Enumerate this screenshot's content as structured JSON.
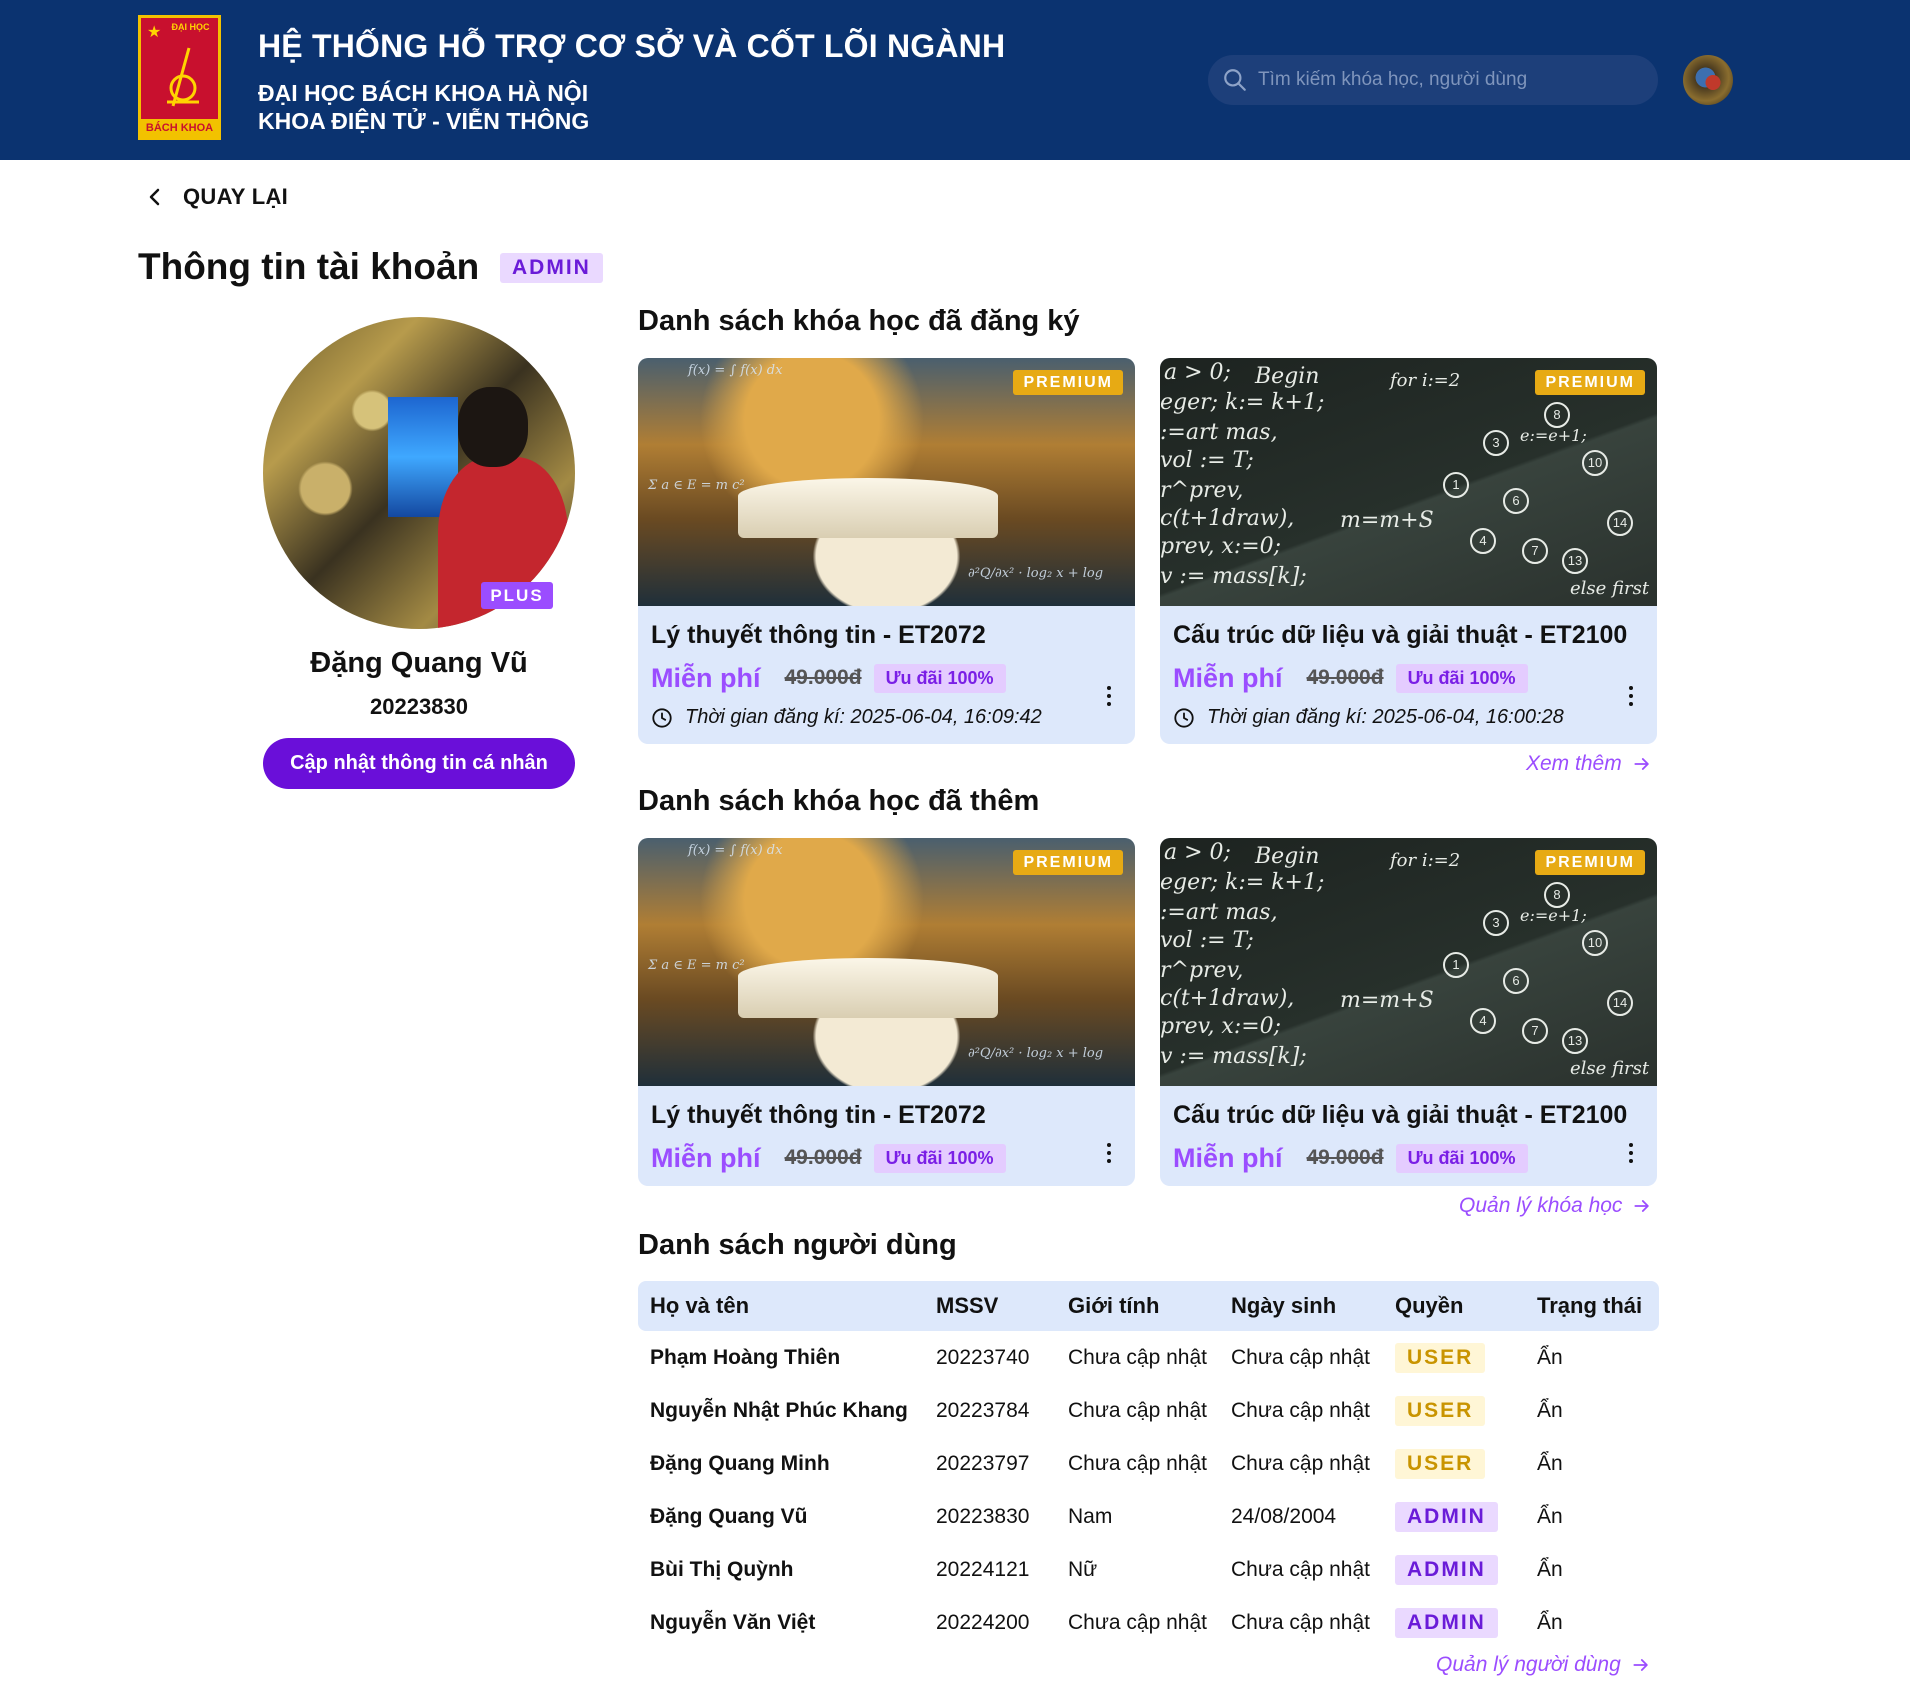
{
  "header": {
    "logo_top_text": "ĐẠI HỌC",
    "logo_bottom_text": "BÁCH KHOA",
    "title": "HỆ THỐNG HỖ TRỢ CƠ SỞ VÀ CỐT LÕI NGÀNH",
    "subtitle_1": "ĐẠI HỌC BÁCH KHOA HÀ NỘI",
    "subtitle_2": "KHOA ĐIỆN TỬ - VIỄN THÔNG",
    "search_placeholder": "Tìm kiếm khóa học, người dùng",
    "search_value": ""
  },
  "nav": {
    "back_label": "QUAY LẠI"
  },
  "page": {
    "title": "Thông tin tài khoản",
    "role_badge": "ADMIN"
  },
  "profile": {
    "tier_badge": "PLUS",
    "name": "Đặng Quang Vũ",
    "student_id": "20223830",
    "update_button": "Cập nhật thông tin cá nhân"
  },
  "registered": {
    "title": "Danh sách khóa học đã đăng ký",
    "more_label": "Xem thêm",
    "courses": [
      {
        "badge": "PREMIUM",
        "title": "Lý thuyết thông tin - ET2072",
        "price": "Miễn phí",
        "old_price": "49.000đ",
        "discount": "Ưu đãi 100%",
        "reg_time": "Thời gian đăng kí: 2025-06-04, 16:09:42"
      },
      {
        "badge": "PREMIUM",
        "title": "Cấu trúc dữ liệu và giải thuật - ET2100",
        "price": "Miễn phí",
        "old_price": "49.000đ",
        "discount": "Ưu đãi 100%",
        "reg_time": "Thời gian đăng kí: 2025-06-04, 16:00:28"
      }
    ]
  },
  "added": {
    "title": "Danh sách khóa học đã thêm",
    "more_label": "Quản lý khóa học",
    "courses": [
      {
        "badge": "PREMIUM",
        "title": "Lý thuyết thông tin - ET2072",
        "price": "Miễn phí",
        "old_price": "49.000đ",
        "discount": "Ưu đãi 100%"
      },
      {
        "badge": "PREMIUM",
        "title": "Cấu trúc dữ liệu và giải thuật - ET2100",
        "price": "Miễn phí",
        "old_price": "49.000đ",
        "discount": "Ưu đãi 100%"
      }
    ]
  },
  "users": {
    "title": "Danh sách người dùng",
    "more_label": "Quản lý người dùng",
    "columns": [
      "Họ và tên",
      "MSSV",
      "Giới tính",
      "Ngày sinh",
      "Quyền",
      "Trạng thái"
    ],
    "rows": [
      [
        "Phạm Hoàng Thiên",
        "20223740",
        "Chưa cập nhật",
        "Chưa cập nhật",
        "USER",
        "Ẩn"
      ],
      [
        "Nguyễn Nhật Phúc Khang",
        "20223784",
        "Chưa cập nhật",
        "Chưa cập nhật",
        "USER",
        "Ẩn"
      ],
      [
        "Đặng Quang Minh",
        "20223797",
        "Chưa cập nhật",
        "Chưa cập nhật",
        "USER",
        "Ẩn"
      ],
      [
        "Đặng Quang Vũ",
        "20223830",
        "Nam",
        "24/08/2004",
        "ADMIN",
        "Ẩn"
      ],
      [
        "Bùi Thị Quỳnh",
        "20224121",
        "Nữ",
        "Chưa cập nhật",
        "ADMIN",
        "Ẩn"
      ],
      [
        "Nguyễn Văn Việt",
        "20224200",
        "Chưa cập nhật",
        "Chưa cập nhật",
        "ADMIN",
        "Ẩn"
      ]
    ]
  },
  "colors": {
    "header_bg": "#0b3370",
    "accent_purple": "#6a0fd9",
    "link_purple": "#9b4dff",
    "premium_gold": "#e7aa14",
    "card_bg": "#dde8fb"
  },
  "icons": {
    "search": "search-icon",
    "back": "chevron-left-icon",
    "clock": "clock-icon",
    "arrow": "arrow-right-icon",
    "menu": "more-vertical-icon"
  }
}
